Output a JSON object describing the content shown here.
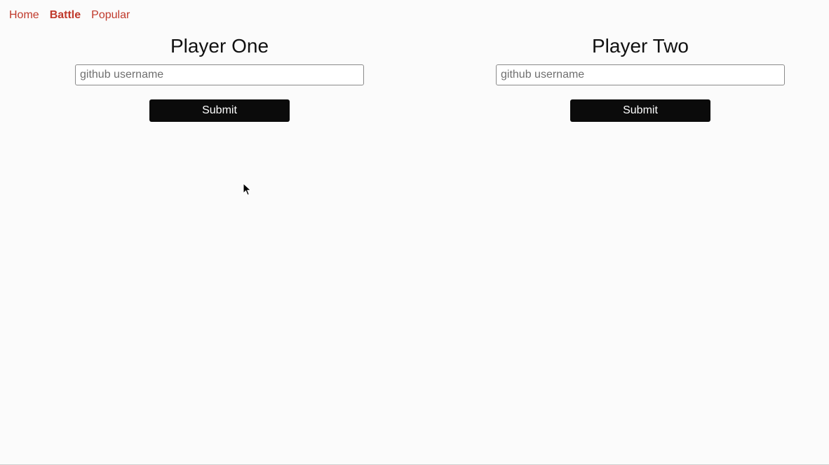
{
  "nav": {
    "items": [
      {
        "label": "Home"
      },
      {
        "label": "Battle"
      },
      {
        "label": "Popular"
      }
    ],
    "active": "Battle",
    "link_color": "#c0392b"
  },
  "players": [
    {
      "title": "Player One",
      "input_value": "",
      "input_placeholder": "github username",
      "submit_label": "Submit"
    },
    {
      "title": "Player Two",
      "input_value": "",
      "input_placeholder": "github username",
      "submit_label": "Submit"
    }
  ],
  "colors": {
    "background": "#fbfbfb",
    "button_bg": "#0b0b0b",
    "button_text": "#ffffff"
  },
  "icons": {
    "cursor": "mouse-pointer-icon"
  }
}
